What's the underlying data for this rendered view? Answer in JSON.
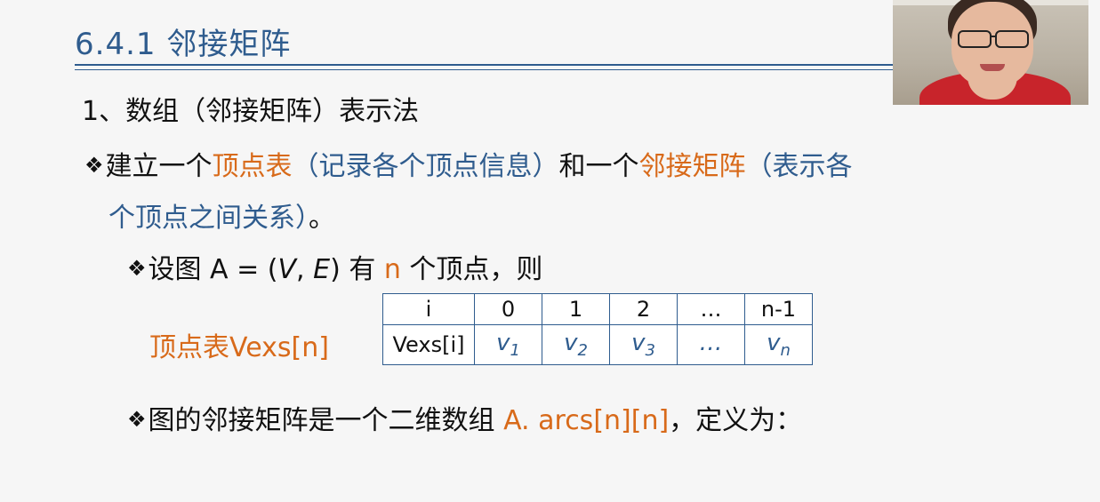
{
  "title": "6.4.1 邻接矩阵",
  "section_heading": "1、数组（邻接矩阵）表示法",
  "bullet_symbol": "❖",
  "bullet1": {
    "p1": "建立一个",
    "p2": "顶点表",
    "p3": "（记录各个顶点信息）",
    "p4": "和一个",
    "p5": "邻接矩阵",
    "p6": "（表示各",
    "p7": "个顶点之间关系）",
    "p8": "。"
  },
  "bullet2": {
    "p1": "设图 A = (",
    "p2": "V",
    "p3": ", ",
    "p4": "E",
    "p5": ") 有 ",
    "p6": "n",
    "p7": " 个顶点，则"
  },
  "vexs_label": "顶点表Vexs[n]",
  "vexs_table": {
    "header": [
      "i",
      "0",
      "1",
      "2",
      "…",
      "n-1"
    ],
    "row_label": "Vexs[i]",
    "cells": [
      {
        "base": "v",
        "sub": "1"
      },
      {
        "base": "v",
        "sub": "2"
      },
      {
        "base": "v",
        "sub": "3"
      },
      {
        "base": "…",
        "sub": ""
      },
      {
        "base": "v",
        "sub": "n"
      }
    ]
  },
  "bullet3": {
    "p1": "图的邻接矩阵是一个二维数组 ",
    "p2": "A. arcs[n][n]",
    "p3": "，定义为："
  },
  "colors": {
    "accent_blue": "#2f5c8e",
    "accent_orange": "#d86a1a"
  }
}
